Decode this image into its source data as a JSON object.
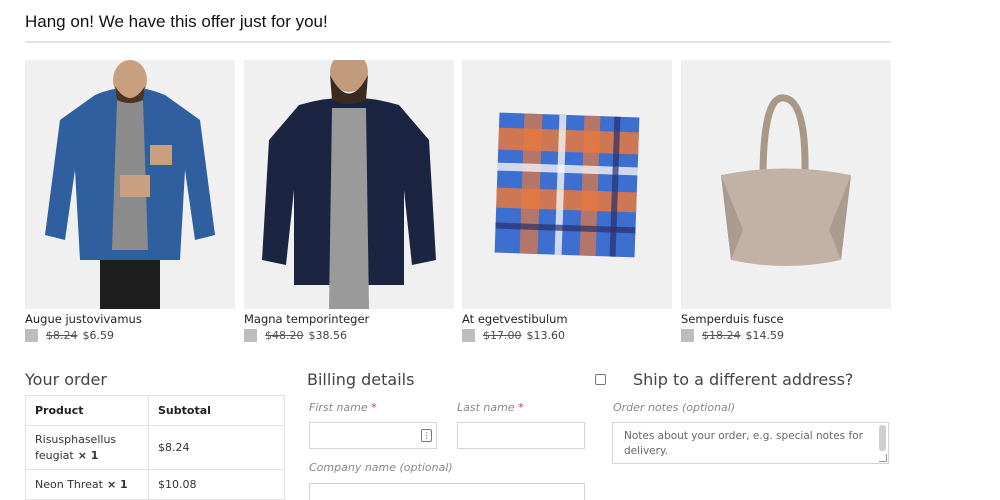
{
  "offer": {
    "headline": "Hang on! We have this offer just for you!"
  },
  "products": [
    {
      "name": "Augue justovivamus",
      "old_price": "$8.24",
      "new_price": "$6.59"
    },
    {
      "name": "Magna temporinteger",
      "old_price": "$48.20",
      "new_price": "$38.56"
    },
    {
      "name": "At egetvestibulum",
      "old_price": "$17.00",
      "new_price": "$13.60"
    },
    {
      "name": "Semperduis fusce",
      "old_price": "$18.24",
      "new_price": "$14.59"
    }
  ],
  "order": {
    "title": "Your order",
    "headers": {
      "product": "Product",
      "subtotal": "Subtotal"
    },
    "rows": [
      {
        "product": "Risusphasellus feugiat",
        "qty": "× 1",
        "subtotal": "$8.24"
      },
      {
        "product": "Neon Threat",
        "qty": "× 1",
        "subtotal": "$10.08"
      }
    ]
  },
  "billing": {
    "title": "Billing details",
    "first_name_label": "First name",
    "last_name_label": "Last name",
    "required_mark": "*",
    "company_label": "Company name (optional)"
  },
  "shipping": {
    "checkbox_label": "Ship to a different address?",
    "notes_label": "Order notes (optional)",
    "notes_placeholder": "Notes about your order, e.g. special notes for delivery."
  },
  "icons": {
    "autofill": "contact-card-icon",
    "product_select": "checkbox-icon"
  },
  "colors": {
    "required": "#dd3333",
    "muted_label": "#888888"
  }
}
